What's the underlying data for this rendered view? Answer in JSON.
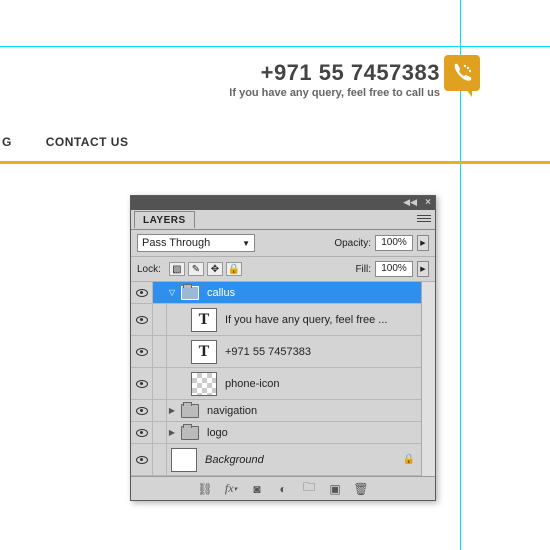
{
  "header": {
    "phone": "+971 55 7457383",
    "query_text": "If you have any query, feel free to call us"
  },
  "nav": {
    "items": [
      "G",
      "CONTACT US"
    ]
  },
  "panel": {
    "tab": "LAYERS",
    "blend_mode": "Pass Through",
    "opacity_label": "Opacity:",
    "opacity_value": "100%",
    "lock_label": "Lock:",
    "fill_label": "Fill:",
    "fill_value": "100%",
    "layers": {
      "group_name": "callus",
      "text1": "If you have any query, feel free ...",
      "text2": "+971 55 7457383",
      "icon_layer": "phone-icon",
      "nav_group": "navigation",
      "logo_group": "logo",
      "background": "Background"
    }
  }
}
